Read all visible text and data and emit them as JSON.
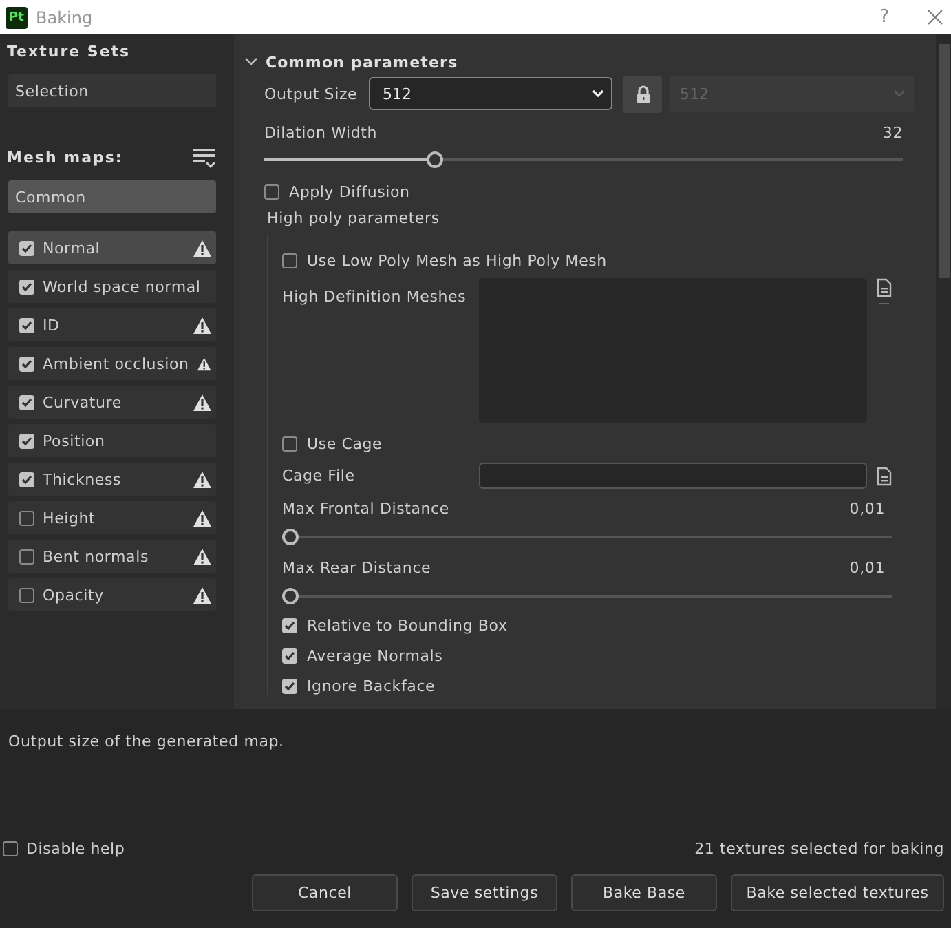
{
  "window": {
    "app_icon": "Pt",
    "title": "Baking",
    "help": "?"
  },
  "sidebar": {
    "texture_sets_heading": "Texture Sets",
    "texture_sets": [
      {
        "label": "Selection",
        "selected": false
      }
    ],
    "mesh_maps_heading": "Mesh maps:",
    "groups": [
      {
        "label": "Common",
        "selected": true
      }
    ],
    "mesh_maps": [
      {
        "label": "Normal",
        "checked": true,
        "selected": true,
        "warning": true
      },
      {
        "label": "World space normal",
        "checked": true,
        "selected": false,
        "warning": false
      },
      {
        "label": "ID",
        "checked": true,
        "selected": false,
        "warning": true
      },
      {
        "label": "Ambient occlusion",
        "checked": true,
        "selected": false,
        "warning": true
      },
      {
        "label": "Curvature",
        "checked": true,
        "selected": false,
        "warning": true
      },
      {
        "label": "Position",
        "checked": true,
        "selected": false,
        "warning": false
      },
      {
        "label": "Thickness",
        "checked": true,
        "selected": false,
        "warning": true
      },
      {
        "label": "Height",
        "checked": false,
        "selected": false,
        "warning": true
      },
      {
        "label": "Bent normals",
        "checked": false,
        "selected": false,
        "warning": true
      },
      {
        "label": "Opacity",
        "checked": false,
        "selected": false,
        "warning": true
      }
    ]
  },
  "section": {
    "title": "Common parameters",
    "expanded": true,
    "output_size": {
      "label": "Output Size",
      "value": "512",
      "locked": true,
      "linked_value": "512",
      "linked_disabled": true
    },
    "rows": [
      {
        "kind": "slider",
        "label": "Dilation Width",
        "reading": "32",
        "level": 0.26
      },
      {
        "kind": "checkbox",
        "label": "Apply Diffusion",
        "checked": false
      }
    ],
    "subsection": {
      "title": "High poly parameters",
      "rows": [
        {
          "kind": "checkbox",
          "label": "Use Low Poly Mesh as High Poly Mesh",
          "checked": false
        },
        {
          "kind": "list",
          "label": "High Definition Meshes"
        },
        {
          "kind": "checkbox",
          "label": "Use Cage",
          "checked": false
        },
        {
          "kind": "file",
          "label": "Cage File"
        },
        {
          "kind": "slider",
          "label": "Max Frontal Distance",
          "reading": "0,01",
          "level": 0.0
        },
        {
          "kind": "slider",
          "label": "Max Rear Distance",
          "reading": "0,01",
          "level": 0.0
        },
        {
          "kind": "checkbox",
          "label": "Relative to Bounding Box",
          "checked": true
        },
        {
          "kind": "checkbox",
          "label": "Average Normals",
          "checked": true
        },
        {
          "kind": "checkbox",
          "label": "Ignore Backface",
          "checked": true
        }
      ]
    }
  },
  "help_text": "Output size of the generated map.",
  "disable_help": {
    "label": "Disable help",
    "checked": false
  },
  "status": "21 textures selected for baking",
  "buttons": [
    "Cancel",
    "Save settings",
    "Bake Base",
    "Bake selected textures"
  ]
}
